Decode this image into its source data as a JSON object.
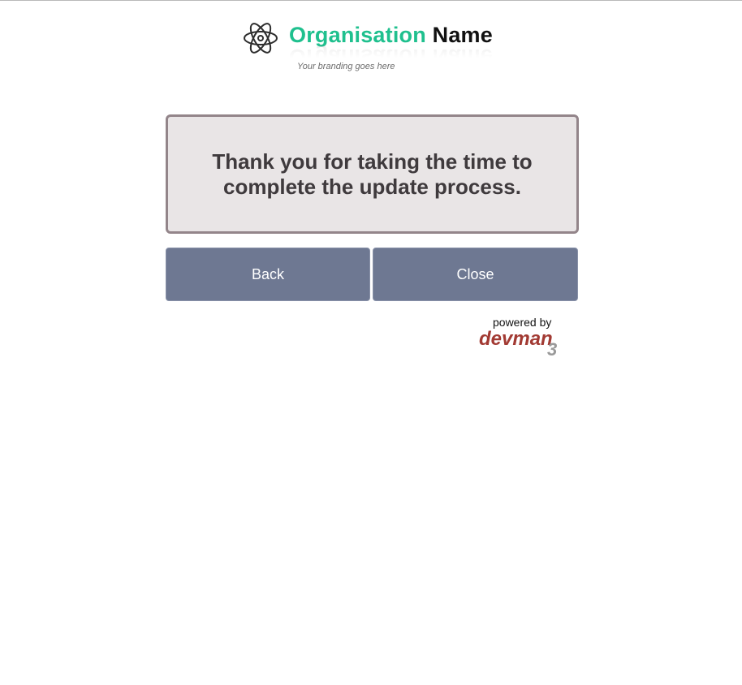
{
  "branding": {
    "org_name_part1": "Organisation",
    "org_name_part2": "Name",
    "tagline": "Your branding goes here",
    "logo_icon": "atom-icon",
    "accent_color": "#1fc08e"
  },
  "message": {
    "text": "Thank you for taking the time to complete the update process."
  },
  "actions": {
    "back_label": "Back",
    "close_label": "Close",
    "button_color": "#6e7892"
  },
  "footer": {
    "powered_by": "powered by",
    "vendor_logo_text": "devman",
    "vendor_logo_version": "3",
    "vendor_color": "#a23a33"
  }
}
